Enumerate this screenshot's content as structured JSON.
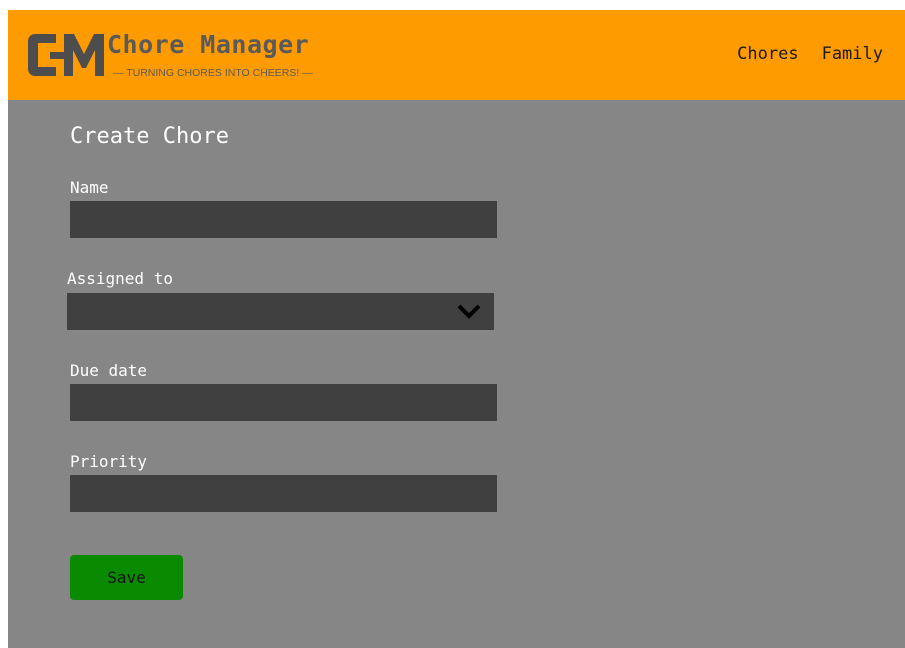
{
  "header": {
    "brand_title": "Chore Manager",
    "brand_tagline": "— TURNING CHORES INTO CHEERS! —",
    "logo_icon": "cm-logo-icon",
    "nav": [
      {
        "label": "Chores"
      },
      {
        "label": "Family"
      }
    ]
  },
  "form": {
    "title": "Create Chore",
    "name": {
      "label": "Name",
      "value": ""
    },
    "assigned_to": {
      "label": "Assigned to",
      "value": "",
      "icon": "chevron-down-icon"
    },
    "due_date": {
      "label": "Due date",
      "value": ""
    },
    "priority": {
      "label": "Priority",
      "value": ""
    },
    "save_label": "Save"
  },
  "colors": {
    "header_bg": "#fe9b00",
    "page_bg": "#868686",
    "input_bg": "#404040",
    "save_button_bg": "#0a8a00",
    "brand_text": "#5a5a5a"
  }
}
